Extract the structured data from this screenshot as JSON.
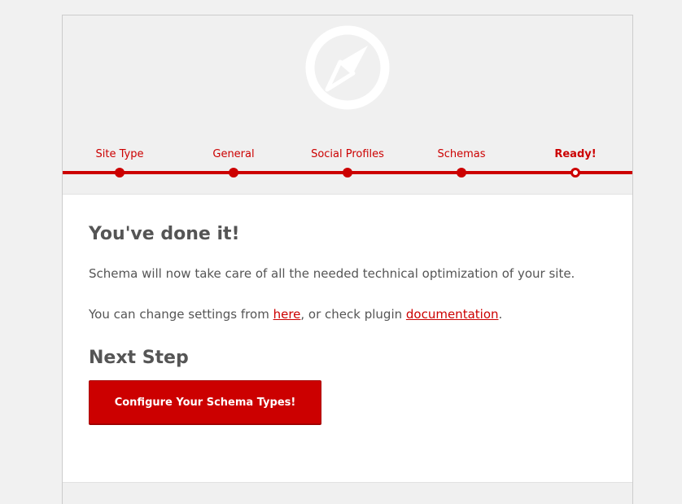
{
  "steps": [
    {
      "label": "Site Type",
      "state": "done"
    },
    {
      "label": "General",
      "state": "done"
    },
    {
      "label": "Social Profiles",
      "state": "done"
    },
    {
      "label": "Schemas",
      "state": "done"
    },
    {
      "label": "Ready!",
      "state": "active"
    }
  ],
  "content": {
    "title": "You've done it!",
    "intro": "Schema will now take care of all the needed technical optimization of your site.",
    "settings_prefix": "You can change settings from ",
    "settings_link": "here",
    "settings_middle": ", or check plugin ",
    "docs_link": "documentation",
    "settings_suffix": ".",
    "next_step_heading": "Next Step",
    "cta_label": "Configure Your Schema Types!"
  },
  "icons": {
    "logo": "compass-icon"
  },
  "colors": {
    "accent": "#cc0000",
    "text": "#555555",
    "background": "#f1f1f1"
  }
}
